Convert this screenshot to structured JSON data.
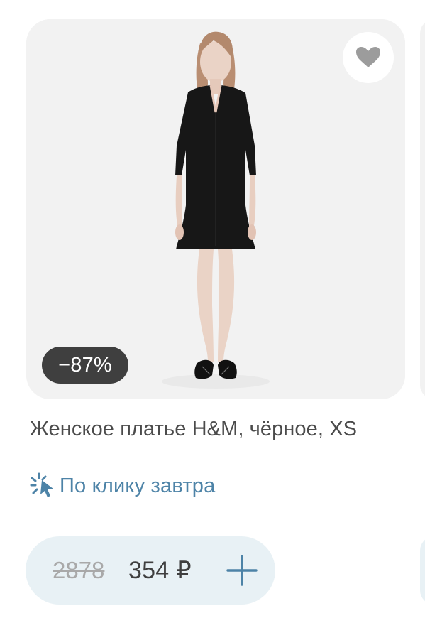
{
  "product": {
    "discount_label": "−87%",
    "title": "Женское платье H&M, чёрное, XS",
    "delivery_text": "По клику завтра",
    "old_price": "2878",
    "current_price": "354 ₽"
  },
  "icons": {
    "favorite": "heart-icon",
    "delivery": "click-sparkle-icon",
    "add": "plus-icon"
  },
  "colors": {
    "image_background": "#f2f2f2",
    "price_pill_background": "#e8f1f5",
    "delivery_text": "#4d83a7",
    "badge_background": "#3f3f3f"
  }
}
